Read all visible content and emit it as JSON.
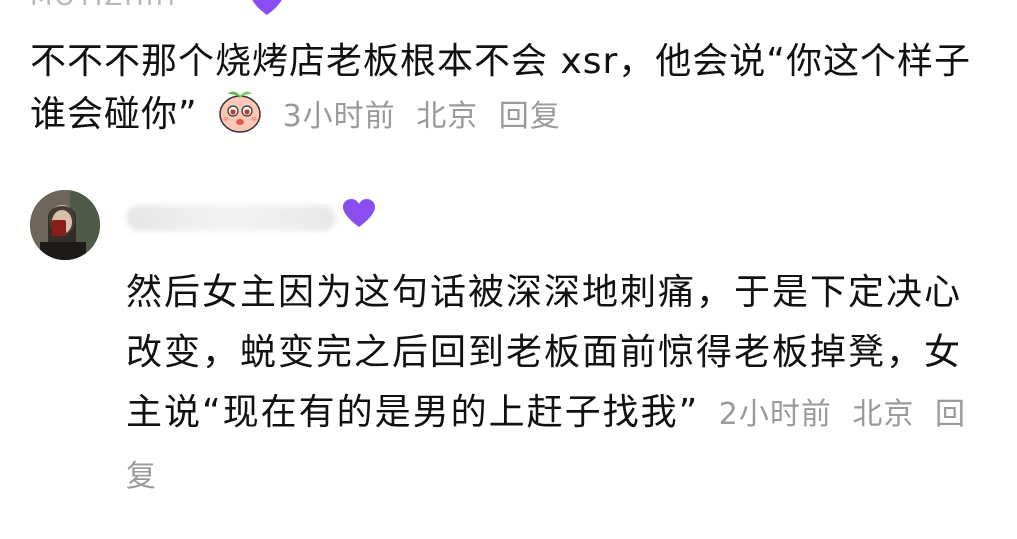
{
  "comments": [
    {
      "author": "MOTIZHIH",
      "text": "不不不那个烧烤店老板根本不会 xsr，他会说“你这个样子谁会碰你”",
      "sticker_icon": "peach-face-sticker-icon",
      "time": "3小时前",
      "location": "北京",
      "reply_label": "回复"
    },
    {
      "author": "",
      "text": "然后女主因为这句话被深深地刺痛，于是下定决心改变，蜕变完之后回到老板面前惊得老板掉凳，女主说“现在有的是男的上赶子找我”",
      "time": "2小时前",
      "location": "北京",
      "reply_label": "回复"
    }
  ],
  "colors": {
    "heart": "#8a4df0",
    "meta_text": "#9a9a9a",
    "body_text": "#111111"
  }
}
